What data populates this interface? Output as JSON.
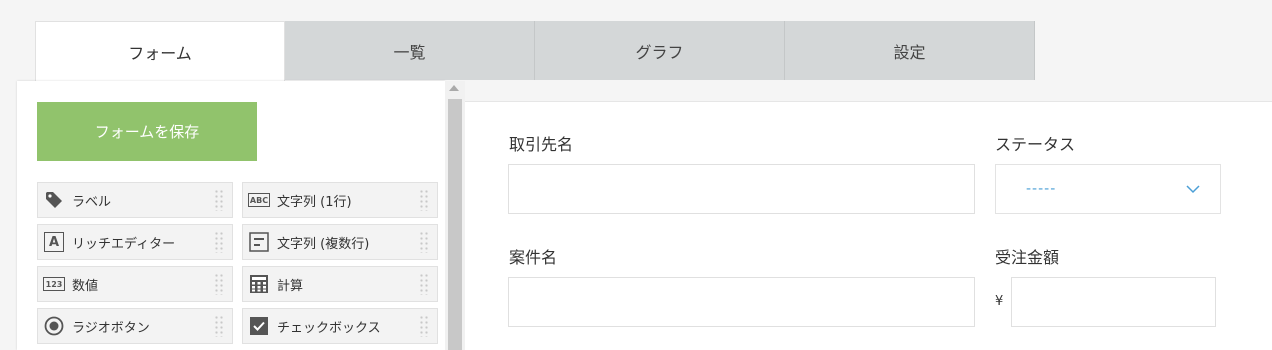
{
  "tabs": [
    {
      "label": "フォーム",
      "active": true
    },
    {
      "label": "一覧"
    },
    {
      "label": "グラフ"
    },
    {
      "label": "設定"
    }
  ],
  "palette": {
    "save_label": "フォームを保存",
    "items": [
      {
        "label": "ラベル",
        "icon": "tag-icon"
      },
      {
        "label": "文字列 (1行)",
        "icon": "abc-icon",
        "icon_text": "ABC"
      },
      {
        "label": "リッチエディター",
        "icon": "rich-editor-icon",
        "icon_text": "A"
      },
      {
        "label": "文字列 (複数行)",
        "icon": "multiline-text-icon"
      },
      {
        "label": "数値",
        "icon": "number-icon",
        "icon_text": "123"
      },
      {
        "label": "計算",
        "icon": "calculator-icon"
      },
      {
        "label": "ラジオボタン",
        "icon": "radio-button-icon"
      },
      {
        "label": "チェックボックス",
        "icon": "checkbox-icon"
      }
    ]
  },
  "form": {
    "client_label": "取引先名",
    "status_label": "ステータス",
    "status_value": "-----",
    "project_label": "案件名",
    "order_amount_label": "受注金額",
    "currency_symbol": "¥"
  },
  "colors": {
    "save_button": "#91c36c",
    "tab_inactive": "#d4d7d8",
    "select_placeholder": "#4b9fd6"
  }
}
